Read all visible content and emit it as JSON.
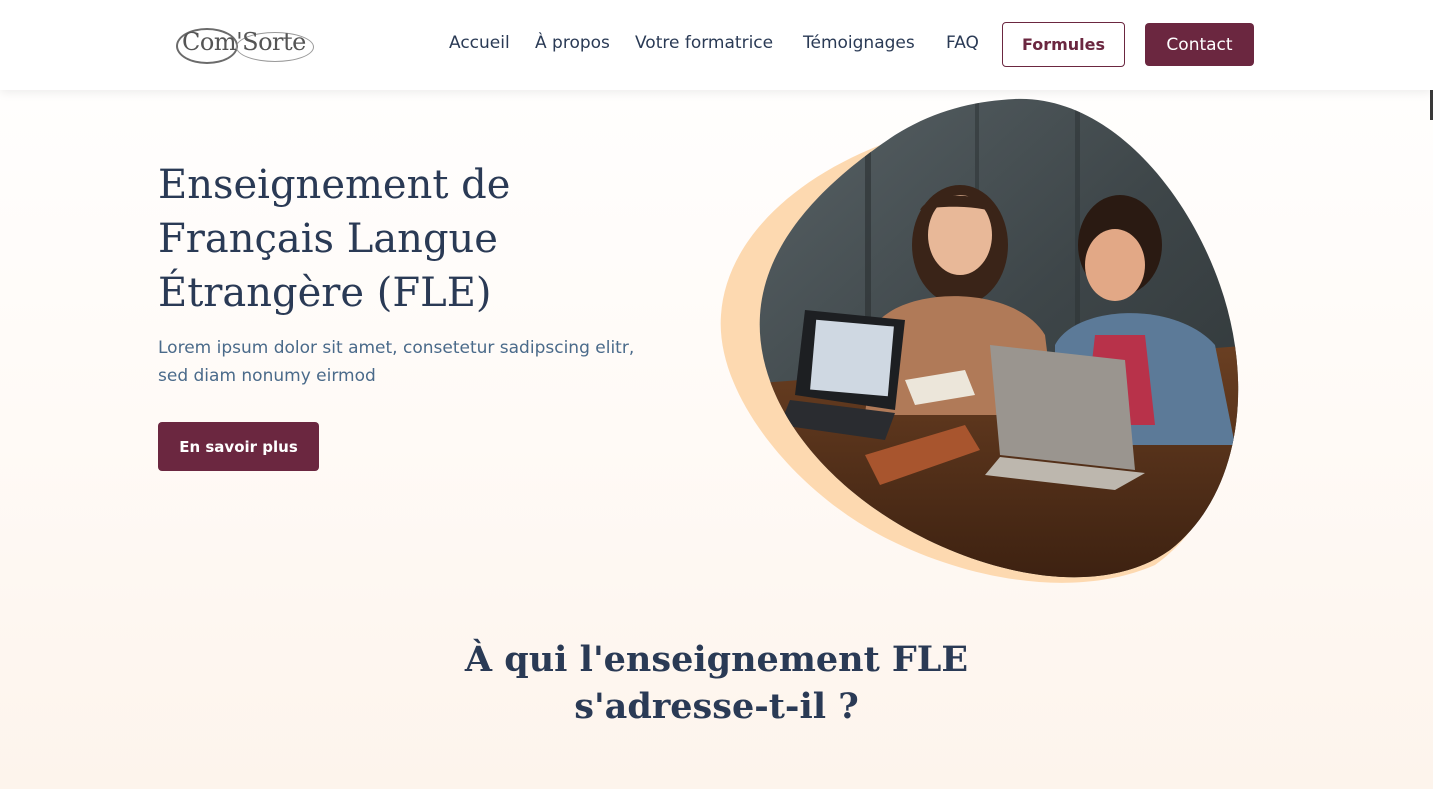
{
  "header": {
    "logo_text": "Com'Sorte",
    "nav": [
      {
        "label": "Accueil"
      },
      {
        "label": "À propos"
      },
      {
        "label": "Votre formatrice"
      },
      {
        "label": "Témoignages"
      },
      {
        "label": "FAQ"
      }
    ],
    "formules_label": "Formules",
    "contact_label": "Contact"
  },
  "hero": {
    "title": "Enseignement de Français Langue Étrangère (FLE)",
    "subtitle": "Lorem ipsum dolor sit amet, consetetur sadipscing elitr, sed diam nonumy eirmod",
    "cta_label": "En savoir plus",
    "image_alt": "Deux personnes souriantes travaillant sur des ordinateurs portables"
  },
  "section": {
    "title_line1": "À qui l'enseignement FLE",
    "title_line2": "s'adresse-t-il ?"
  },
  "colors": {
    "brand": "#6b2740",
    "heading": "#2a3a55",
    "body_text": "#4a6a8a",
    "blob_accent": "#fdd9b0"
  }
}
